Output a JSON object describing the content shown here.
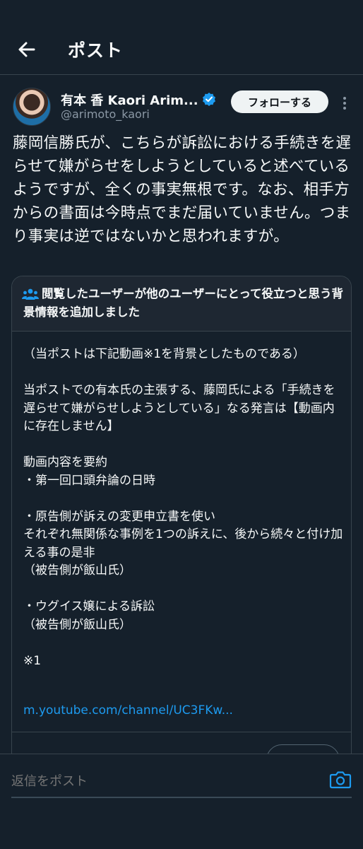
{
  "header": {
    "title": "ポスト"
  },
  "author": {
    "name": "有本 香 Kaori Arim...",
    "handle": "@arimoto_kaori",
    "follow_label": "フォローする"
  },
  "tweet": {
    "text": "藤岡信勝氏が、こちらが訴訟における手続きを遅らせて嫌がらせをしようとしていると述べているようですが、全くの事実無根です。なお、相手方からの書面は今時点でまだ届いていません。つまり事実は逆ではないかと思われますが。"
  },
  "community_note": {
    "title": "閲覧したユーザーが他のユーザーにとって役立つと思う背景情報を追加しました",
    "body": "（当ポストは下記動画※1を背景としたものである）\n\n当ポストでの有本氏の主張する、藤岡氏による「手続きを遅らせて嫌がらせしようとしている」なる発言は【動画内に存在しません】\n\n動画内容を要約\n・第一回口頭弁論の日時\n\n・原告側が訴えの変更申立書を使い\nそれぞれ無関係な事例を1つの訴えに、後から続々と付け加える事の是非\n（被告側が飯山氏）\n\n・ウグイス嬢による訴訟\n（被告側が飯山氏）\n\n※1",
    "link": "m.youtube.com/channel/UC3FKw..."
  },
  "reply": {
    "placeholder": "返信をポスト"
  },
  "colors": {
    "background": "#15202b",
    "accent": "#1d9bf0",
    "border": "#38444d",
    "muted": "#8b98a5"
  }
}
